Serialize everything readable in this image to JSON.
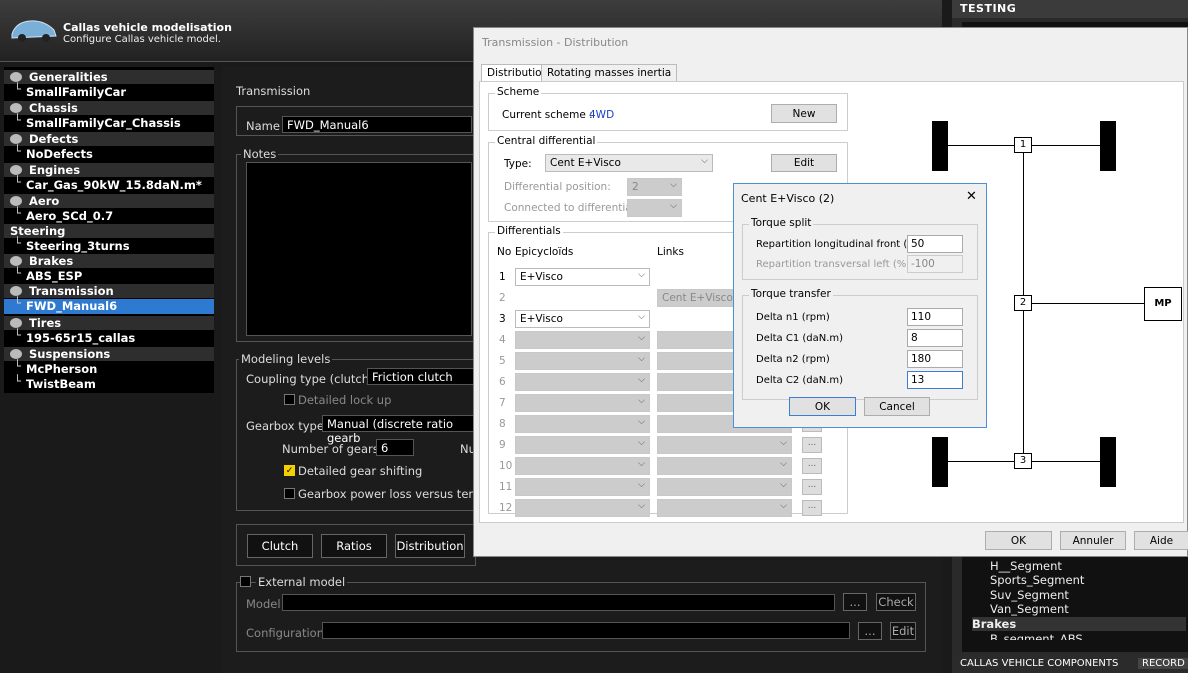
{
  "app": {
    "title": "Callas vehicle modelisation",
    "subtitle": "Configure Callas vehicle model."
  },
  "right_panel": {
    "title": "TESTING",
    "items": [
      "H__Segment",
      "Sports_Segment",
      "Suv_Segment",
      "Van_Segment"
    ],
    "section": "Brakes",
    "partial_item": "B_segment_ABS",
    "bottom_tabs": [
      "CALLAS VEHICLE COMPONENTS",
      "RECORD"
    ]
  },
  "tree": [
    {
      "type": "node",
      "label": "Generalities"
    },
    {
      "type": "leaf",
      "label": "SmallFamilyCar"
    },
    {
      "type": "node",
      "label": "Chassis"
    },
    {
      "type": "leaf",
      "label": "SmallFamilyCar_Chassis"
    },
    {
      "type": "node",
      "label": "Defects"
    },
    {
      "type": "leaf",
      "label": "NoDefects"
    },
    {
      "type": "node",
      "label": "Engines"
    },
    {
      "type": "leaf",
      "label": "Car_Gas_90kW_15.8daN.m*"
    },
    {
      "type": "node",
      "label": "Aero"
    },
    {
      "type": "leaf",
      "label": "Aero_SCd_0.7"
    },
    {
      "type": "node",
      "label": "Steering"
    },
    {
      "type": "leaf",
      "label": "Steering_3turns"
    },
    {
      "type": "node",
      "label": "Brakes"
    },
    {
      "type": "leaf",
      "label": "ABS_ESP"
    },
    {
      "type": "node",
      "label": "Transmission"
    },
    {
      "type": "leaf",
      "label": "FWD_Manual6",
      "selected": true
    },
    {
      "type": "node",
      "label": "Tires"
    },
    {
      "type": "leaf",
      "label": "195-65r15_callas"
    },
    {
      "type": "node",
      "label": "Suspensions"
    },
    {
      "type": "leaf",
      "label": "McPherson"
    },
    {
      "type": "leaf",
      "label": "TwistBeam"
    }
  ],
  "main": {
    "section_title": "Transmission",
    "name_label": "Name",
    "name_value": "FWD_Manual6",
    "notes_label": "Notes",
    "modeling_levels": "Modeling levels",
    "coupling_label": "Coupling type (clutch)",
    "coupling_value": "Friction clutch",
    "detailed_lockup": "Detailed lock up",
    "gearbox_label": "Gearbox type",
    "gearbox_value": "Manual (discrete ratio gearb",
    "num_gears_label": "Number of gears",
    "num_gears_value": "6",
    "nu_label": "Nu",
    "detailed_gear": "Detailed gear shifting",
    "gearbox_loss": "Gearbox power loss versus tempe",
    "buttons": [
      "Clutch",
      "Ratios",
      "Distribution"
    ],
    "external_model": "External model",
    "model_label": "Model",
    "configuration_label": "Configuration",
    "check_label": "Check",
    "edit_label": "Edit",
    "dots": "..."
  },
  "dialog": {
    "title": "Transmission - Distribution",
    "tabs": [
      "Distribution",
      "Rotating masses inertia"
    ],
    "scheme_group": "Scheme",
    "current_scheme_label": "Current scheme :",
    "current_scheme_value": "4WD",
    "new_button": "New",
    "central_group": "Central differential",
    "type_label": "Type:",
    "type_value": "Cent E+Visco",
    "edit_button": "Edit",
    "diff_position_label": "Differential position:",
    "diff_position_value": "2",
    "connected_label": "Connected to differential:",
    "differentials_group": "Differentials",
    "col_no": "No",
    "col_epi": "Epicycloïds",
    "col_links": "Links",
    "rows": [
      {
        "n": "1",
        "epi": "E+Visco",
        "link": ""
      },
      {
        "n": "2",
        "epi": "",
        "link": "Cent E+Visco"
      },
      {
        "n": "3",
        "epi": "E+Visco",
        "link": ""
      },
      {
        "n": "4",
        "epi": "",
        "link": ""
      },
      {
        "n": "5",
        "epi": "",
        "link": ""
      },
      {
        "n": "6",
        "epi": "",
        "link": ""
      },
      {
        "n": "7",
        "epi": "",
        "link": ""
      },
      {
        "n": "8",
        "epi": "",
        "link": ""
      },
      {
        "n": "9",
        "epi": "",
        "link": ""
      },
      {
        "n": "10",
        "epi": "",
        "link": ""
      },
      {
        "n": "11",
        "epi": "",
        "link": ""
      },
      {
        "n": "12",
        "epi": "",
        "link": ""
      }
    ],
    "footer": [
      "OK",
      "Annuler",
      "Aide"
    ],
    "schema": {
      "nodes": [
        "1",
        "2",
        "3"
      ],
      "mp": "MP"
    }
  },
  "subdialog": {
    "title": "Cent E+Visco (2)",
    "close": "✕",
    "torque_split": "Torque split",
    "rep_long_label": "Repartition  longitudinal front (%)",
    "rep_long_value": "50",
    "rep_trans_label": "Repartition  transversal left (%)",
    "rep_trans_value": "-100",
    "torque_transfer": "Torque transfer",
    "fields": [
      {
        "label": "Delta n1 (rpm)",
        "value": "110"
      },
      {
        "label": "Delta C1 (daN.m)",
        "value": "8"
      },
      {
        "label": "Delta n2 (rpm)",
        "value": "180"
      },
      {
        "label": "Delta C2 (daN.m)",
        "value": "13"
      }
    ],
    "ok": "OK",
    "cancel": "Cancel"
  }
}
